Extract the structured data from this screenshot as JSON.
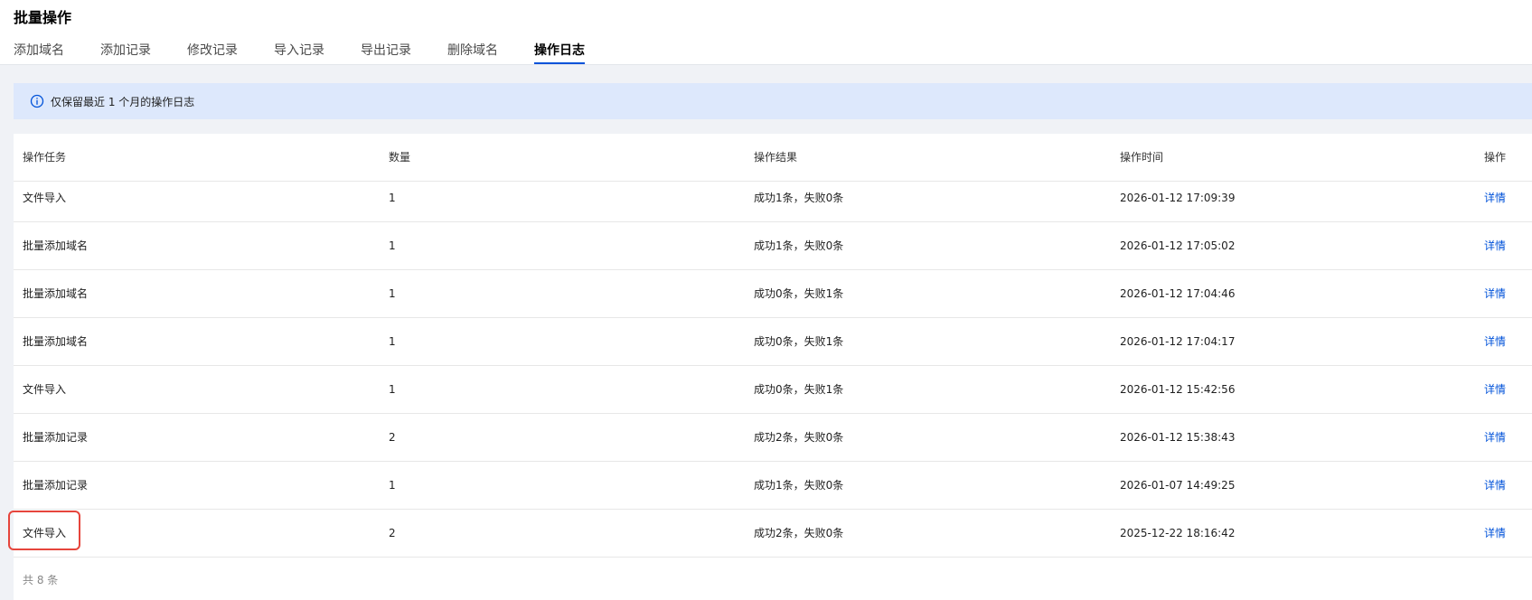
{
  "page": {
    "title": "批量操作"
  },
  "tabs": [
    {
      "label": "添加域名",
      "active": false
    },
    {
      "label": "添加记录",
      "active": false
    },
    {
      "label": "修改记录",
      "active": false
    },
    {
      "label": "导入记录",
      "active": false
    },
    {
      "label": "导出记录",
      "active": false
    },
    {
      "label": "删除域名",
      "active": false
    },
    {
      "label": "操作日志",
      "active": true
    }
  ],
  "notice": {
    "icon": "info-icon",
    "text": "仅保留最近 1 个月的操作日志"
  },
  "table": {
    "columns": [
      "操作任务",
      "数量",
      "操作结果",
      "操作时间",
      "操作"
    ],
    "rows": [
      {
        "task": "文件导入",
        "count": "1",
        "result": "成功1条，失败0条",
        "time": "2026-01-12 17:09:39",
        "action": "详情"
      },
      {
        "task": "批量添加域名",
        "count": "1",
        "result": "成功1条，失败0条",
        "time": "2026-01-12 17:05:02",
        "action": "详情"
      },
      {
        "task": "批量添加域名",
        "count": "1",
        "result": "成功0条，失败1条",
        "time": "2026-01-12 17:04:46",
        "action": "详情"
      },
      {
        "task": "批量添加域名",
        "count": "1",
        "result": "成功0条，失败1条",
        "time": "2026-01-12 17:04:17",
        "action": "详情"
      },
      {
        "task": "文件导入",
        "count": "1",
        "result": "成功0条，失败1条",
        "time": "2026-01-12 15:42:56",
        "action": "详情"
      },
      {
        "task": "批量添加记录",
        "count": "2",
        "result": "成功2条，失败0条",
        "time": "2026-01-12 15:38:43",
        "action": "详情"
      },
      {
        "task": "批量添加记录",
        "count": "1",
        "result": "成功1条，失败0条",
        "time": "2026-01-07 14:49:25",
        "action": "详情"
      },
      {
        "task": "文件导入",
        "count": "2",
        "result": "成功2条，失败0条",
        "time": "2025-12-22 18:16:42",
        "action": "详情"
      }
    ]
  },
  "footer": {
    "total": "共 8 条"
  },
  "colors": {
    "accent": "#0052d9",
    "notice_bg": "#dde8fc",
    "highlight": "#e6453c"
  }
}
